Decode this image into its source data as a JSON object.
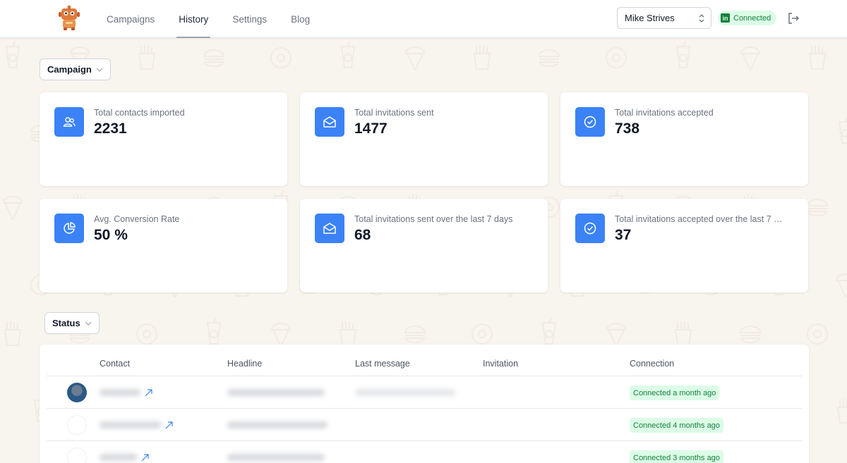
{
  "nav": {
    "items": [
      {
        "label": "Campaigns",
        "active": false
      },
      {
        "label": "History",
        "active": true
      },
      {
        "label": "Settings",
        "active": false
      },
      {
        "label": "Blog",
        "active": false
      }
    ]
  },
  "account": {
    "user_name": "Mike Strives",
    "linkedin_status": "Connected",
    "linkedin_icon": "in"
  },
  "filters": {
    "campaign_label": "Campaign",
    "status_label": "Status"
  },
  "stats": [
    {
      "label": "Total contacts imported",
      "value": "2231",
      "icon": "users-icon"
    },
    {
      "label": "Total invitations sent",
      "value": "1477",
      "icon": "envelope-open-icon"
    },
    {
      "label": "Total invitations accepted",
      "value": "738",
      "icon": "check-circle-icon"
    },
    {
      "label": "Avg. Conversion Rate",
      "value": "50 %",
      "icon": "pie-chart-icon"
    },
    {
      "label": "Total invitations sent over the last 7 days",
      "value": "68",
      "icon": "envelope-open-icon"
    },
    {
      "label": "Total invitations accepted over the last 7 …",
      "value": "37",
      "icon": "check-circle-icon"
    }
  ],
  "table": {
    "columns": [
      "Contact",
      "Headline",
      "Last message",
      "Invitation",
      "Connection"
    ],
    "rows": [
      {
        "connection": "Connected a month ago"
      },
      {
        "connection": "Connected 4 months ago"
      },
      {
        "connection": "Connected 3 months ago"
      }
    ]
  },
  "colors": {
    "accent": "#3b82f6",
    "success_bg": "#dcfce7",
    "success_text": "#15803d",
    "page_bg": "#f8f4ee"
  }
}
